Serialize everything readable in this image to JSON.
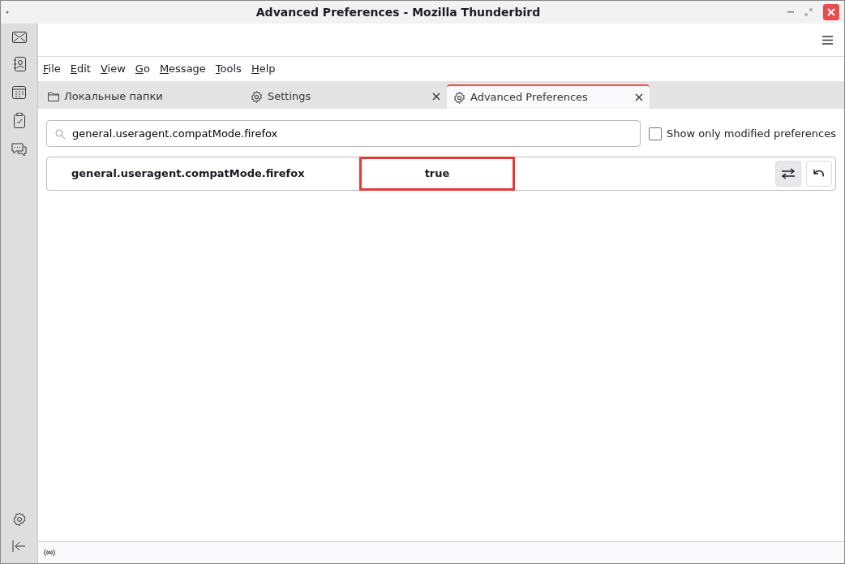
{
  "window": {
    "title": "Advanced Preferences - Mozilla Thunderbird"
  },
  "menu": [
    "File",
    "Edit",
    "View",
    "Go",
    "Message",
    "Tools",
    "Help"
  ],
  "tabs": [
    {
      "label": "Локальные папки",
      "kind": "folder",
      "closable": false,
      "selected": false
    },
    {
      "label": "Settings",
      "kind": "settings",
      "closable": true,
      "selected": false
    },
    {
      "label": "Advanced Preferences",
      "kind": "settings",
      "closable": true,
      "selected": true
    }
  ],
  "search": {
    "value": "general.useragent.compatMode.firefox"
  },
  "show_only_modified": {
    "label": "Show only modified preferences",
    "checked": false
  },
  "preferences": [
    {
      "name": "general.useragent.compatMode.firefox",
      "value": "true",
      "highlighted": true,
      "modified": true
    }
  ]
}
